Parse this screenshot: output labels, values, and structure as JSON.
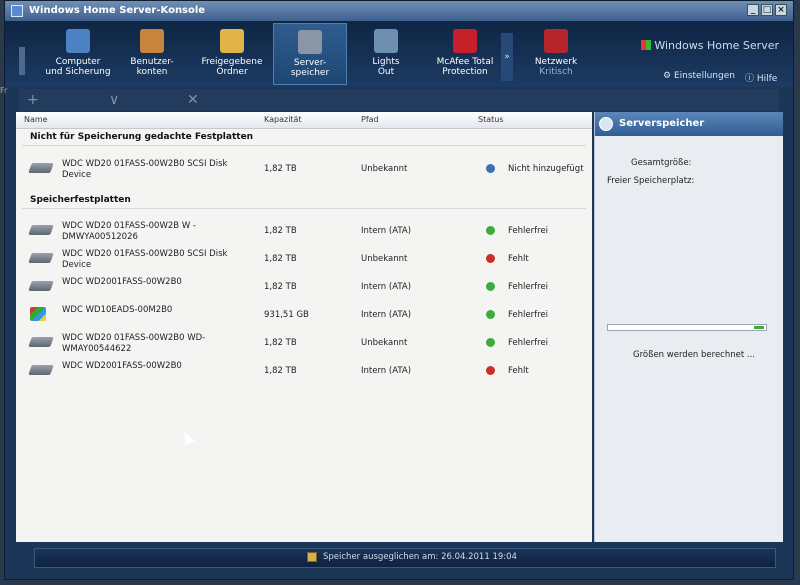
{
  "window": {
    "title": "Windows Home Server-Konsole"
  },
  "nav": {
    "items": [
      {
        "line1": "Computer",
        "line2": "und Sicherung",
        "color": "#4a82c4"
      },
      {
        "line1": "Benutzer-",
        "line2": "konten",
        "color": "#c8843c"
      },
      {
        "line1": "Freigegebene",
        "line2": "Ordner",
        "color": "#e0b447"
      },
      {
        "line1": "Server-",
        "line2": "speicher",
        "color": "#8a96a5"
      },
      {
        "line1": "Lights",
        "line2": "Out",
        "color": "#6f8fb0"
      },
      {
        "line1": "McAfee Total",
        "line2": "Protection",
        "color": "#c8202a"
      },
      {
        "line1": "Netzwerk",
        "line2": "Kritisch",
        "color": "#b6252b"
      }
    ],
    "more_label": "»",
    "brand": "Windows Home Server",
    "settings_label": "Einstellungen",
    "help_label": "Hilfe"
  },
  "toolbar": {
    "add": "+",
    "remove": "∨",
    "close": "✕"
  },
  "frame_label": "Fr",
  "table": {
    "columns": [
      "Name",
      "Kapazität",
      "Pfad",
      "Status"
    ],
    "section1_title": "Nicht für Speicherung gedachte Festplatten",
    "section2_title": "Speicherfestplatten",
    "section1_rows": [
      {
        "name": "WDC WD20 01FASS-00W2B0 SCSI Disk Device",
        "capacity": "1,82 TB",
        "path": "Unbekannt",
        "status": "Nicht hinzugefügt",
        "status_color": "#3b6fb0",
        "icon": "disk-icon"
      }
    ],
    "section2_rows": [
      {
        "name": "WDC WD20 01FASS-00W2B W - DMWYA00512026",
        "capacity": "1,82 TB",
        "path": "Intern (ATA)",
        "status": "Fehlerfrei",
        "status_color": "#3dac3d",
        "icon": "disk-icon"
      },
      {
        "name": "WDC WD20 01FASS-00W2B0 SCSI Disk Device",
        "capacity": "1,82 TB",
        "path": "Unbekannt",
        "status": "Fehlt",
        "status_color": "#c8302c",
        "icon": "disk-icon"
      },
      {
        "name": "WDC WD2001FASS-00W2B0",
        "capacity": "1,82 TB",
        "path": "Intern (ATA)",
        "status": "Fehlerfrei",
        "status_color": "#3dac3d",
        "icon": "disk-icon"
      },
      {
        "name": "WDC WD10EADS-00M2B0",
        "capacity": "931,51 GB",
        "path": "Intern (ATA)",
        "status": "Fehlerfrei",
        "status_color": "#3dac3d",
        "icon": "windows-disk-icon"
      },
      {
        "name": "WDC WD20 01FASS-00W2B0 WD- WMAY00544622",
        "capacity": "1,82 TB",
        "path": "Unbekannt",
        "status": "Fehlerfrei",
        "status_color": "#3dac3d",
        "icon": "disk-icon"
      },
      {
        "name": "WDC WD2001FASS-00W2B0",
        "capacity": "1,82 TB",
        "path": "Intern (ATA)",
        "status": "Fehlt",
        "status_color": "#c8302c",
        "icon": "disk-icon"
      }
    ]
  },
  "right_pane": {
    "title": "Serverspeicher",
    "total_label": "Gesamtgröße:",
    "free_label": "Freier Speicherplatz:",
    "calc_text": "Größen werden berechnet ..."
  },
  "statusbar": {
    "text": "Speicher ausgeglichen am: 26.04.2011 19:04"
  }
}
